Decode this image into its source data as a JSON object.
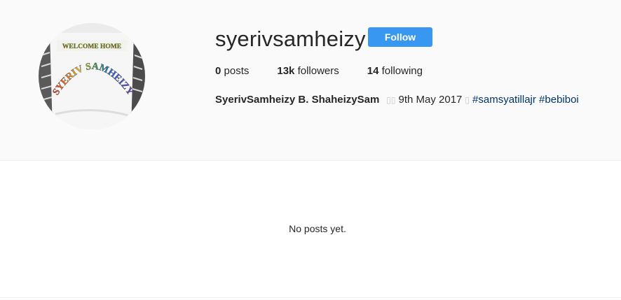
{
  "profile": {
    "username": "syerivsamheizy",
    "follow_label": "Follow",
    "stats": {
      "posts_count": "0",
      "posts_label": "posts",
      "followers_count": "13k",
      "followers_label": "followers",
      "following_count": "14",
      "following_label": "following"
    },
    "bio": {
      "full_name": "SyerivSamheizy B. ShaheizySam",
      "glyph_a": "▯▯",
      "date_text": "9th May 2017",
      "glyph_b": "▯",
      "hashtags": [
        "#samsyatillajr",
        "#bebiboi"
      ]
    },
    "avatar": {
      "banner_text": "WELCOME HOME",
      "arc_text": "SYERIV SAMHEIZY"
    }
  },
  "feed": {
    "empty_message": "No posts yet."
  },
  "colors": {
    "follow_button": "#3897f0",
    "hashtag": "#003569",
    "header_bg": "#fafafa"
  }
}
